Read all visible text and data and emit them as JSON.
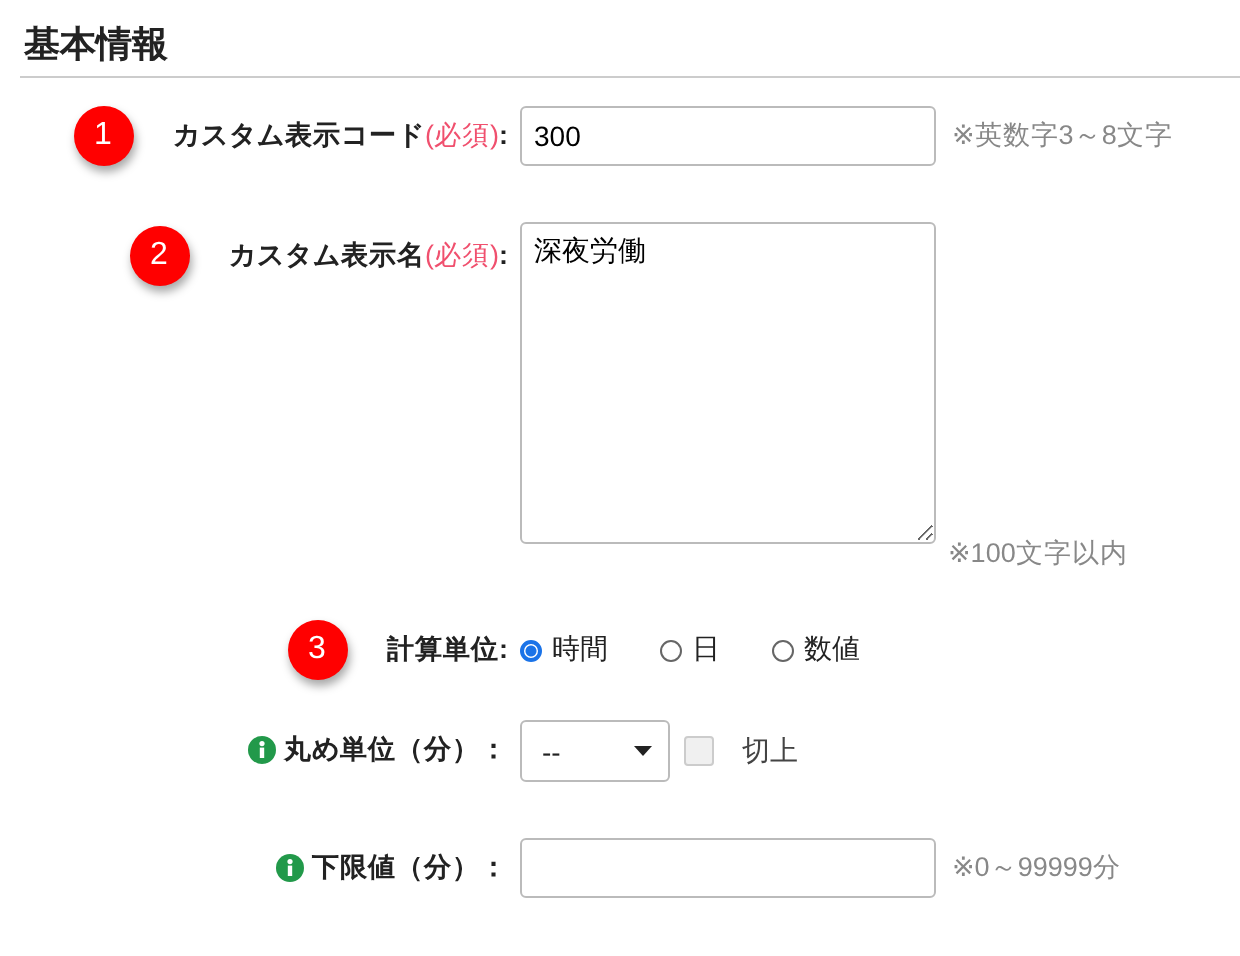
{
  "heading": "基本情報",
  "fields": [
    {
      "kind": "text",
      "badge": "1",
      "label": "カスタム表示コード",
      "required": "(必須)",
      "colon": ":",
      "value": "300",
      "hint": "※英数字3～8文字"
    },
    {
      "kind": "textarea",
      "badge": "2",
      "label": "カスタム表示名",
      "required": "(必須)",
      "colon": ":",
      "value": "深夜労働",
      "hint": "※100文字以内"
    },
    {
      "kind": "radio",
      "badge": "3",
      "label": "計算単位:",
      "options": [
        {
          "label": "時間",
          "selected": true
        },
        {
          "label": "日",
          "selected": false
        },
        {
          "label": "数値",
          "selected": false
        }
      ]
    },
    {
      "kind": "select",
      "info": true,
      "label": "丸め単位（分）：",
      "value": "--",
      "checkbox": {
        "label": "切上",
        "checked": false,
        "disabled": true
      }
    },
    {
      "kind": "text",
      "info": true,
      "label": "下限値（分）：",
      "hint": "※0～99999分"
    }
  ]
}
